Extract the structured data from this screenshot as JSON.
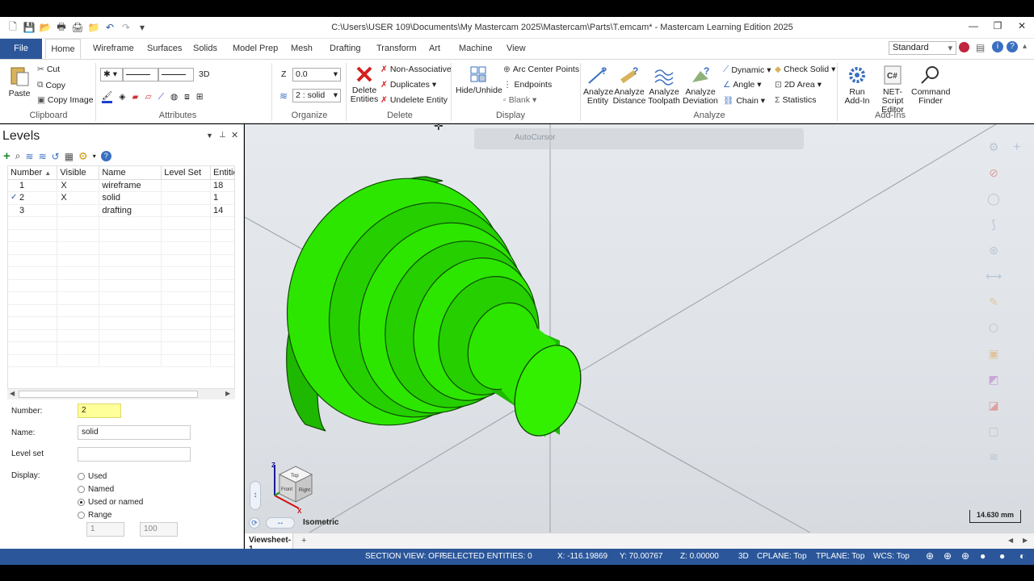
{
  "window": {
    "title": "C:\\Users\\USER 109\\Documents\\My Mastercam 2025\\Mastercam\\Parts\\T.emcam* - Mastercam Learning Edition 2025"
  },
  "tabs": [
    {
      "label": "File"
    },
    {
      "label": "Home"
    },
    {
      "label": "Wireframe"
    },
    {
      "label": "Surfaces"
    },
    {
      "label": "Solids"
    },
    {
      "label": "Model Prep"
    },
    {
      "label": "Mesh"
    },
    {
      "label": "Drafting"
    },
    {
      "label": "Transform"
    },
    {
      "label": "Art"
    },
    {
      "label": "Machine"
    },
    {
      "label": "View"
    }
  ],
  "workspace_select": "Standard",
  "ribbon": {
    "clipboard": {
      "paste": "Paste",
      "cut": "Cut",
      "copy": "Copy",
      "copy_image": "Copy Image",
      "label": "Clipboard"
    },
    "attributes": {
      "label": "Attributes",
      "mode3d": "3D"
    },
    "organize": {
      "z_label": "Z",
      "z_value": "0.0",
      "level_value": "2 : solid",
      "label": "Organize"
    },
    "delete": {
      "delete_entities": "Delete Entities",
      "non_associative": "Non-Associative",
      "duplicates": "Duplicates",
      "undelete": "Undelete Entity",
      "label": "Delete"
    },
    "display": {
      "hide_unhide": "Hide/Unhide",
      "arc_center": "Arc Center Points",
      "endpoints": "Endpoints",
      "blank": "Blank",
      "label": "Display"
    },
    "analyze": {
      "entity": "Analyze Entity",
      "distance": "Analyze Distance",
      "toolpath": "Analyze Toolpath",
      "deviation": "Analyze Deviation",
      "dynamic": "Dynamic",
      "angle": "Angle",
      "chain": "Chain",
      "check_solid": "Check Solid",
      "area_2d": "2D Area",
      "statistics": "Statistics",
      "label": "Analyze"
    },
    "addins": {
      "run": "Run Add-In",
      "net_script": "NET-Script Editor",
      "command_finder": "Command Finder",
      "label": "Add-Ins"
    }
  },
  "levels_panel": {
    "title": "Levels",
    "columns": [
      "Number",
      "Visible",
      "Name",
      "Level Set",
      "Entitie"
    ],
    "rows": [
      {
        "number": "1",
        "visible": "X",
        "name": "wireframe",
        "level_set": "",
        "entities": "18",
        "active": false
      },
      {
        "number": "2",
        "visible": "X",
        "name": "solid",
        "level_set": "",
        "entities": "1",
        "active": true
      },
      {
        "number": "3",
        "visible": "",
        "name": "drafting",
        "level_set": "",
        "entities": "14",
        "active": false
      }
    ],
    "form": {
      "number_label": "Number:",
      "number_value": "2",
      "name_label": "Name:",
      "name_value": "solid",
      "level_set_label": "Level set",
      "level_set_value": "",
      "display_label": "Display:",
      "options": [
        "Used",
        "Named",
        "Used or named",
        "Range"
      ],
      "selected_option": "Used or named",
      "range_from": "1",
      "range_to": "100"
    }
  },
  "viewport": {
    "autocursor": "AutoCursor",
    "view_name": "Isometric",
    "scale": "14.630 mm",
    "cube_faces": {
      "top": "Top",
      "front": "Front",
      "right": "Right"
    },
    "axes": {
      "z": "Z",
      "x": "X"
    }
  },
  "viewsheet": {
    "tab": "Viewsheet-1",
    "add": "+"
  },
  "status": {
    "section_view": "SECTION VIEW: OFF",
    "selected": "SELECTED ENTITIES: 0",
    "x": "X:   -116.19869",
    "y": "Y:   70.00767",
    "z": "Z:   0.00000",
    "mode": "3D",
    "cplane": "CPLANE: Top",
    "tplane": "TPLANE: Top",
    "wcs": "WCS: Top"
  },
  "colors": {
    "accent": "#2b579a",
    "solid_green": "#22e000",
    "highlight_field": "#ffff99"
  }
}
